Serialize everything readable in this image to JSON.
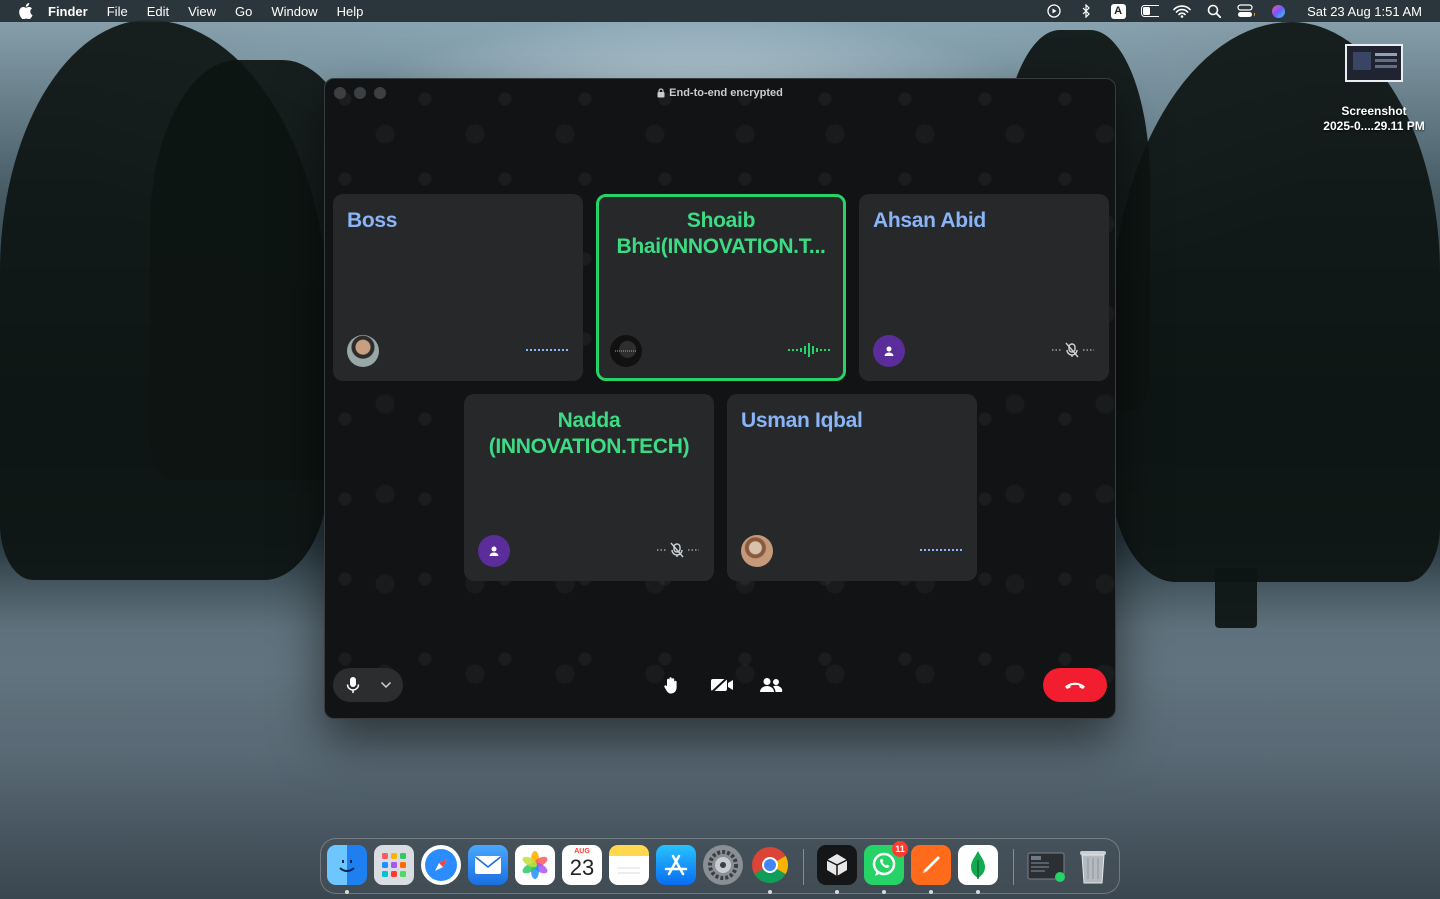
{
  "menubar": {
    "app_name": "Finder",
    "menus": [
      "File",
      "Edit",
      "View",
      "Go",
      "Window",
      "Help"
    ],
    "keyboard_input": "A",
    "clock": "Sat 23 Aug  1:51 AM"
  },
  "desktop": {
    "file_name_line1": "Screenshot",
    "file_name_line2": "2025-0....29.11 PM"
  },
  "call": {
    "encryption_label": "End-to-end encrypted",
    "participants": [
      {
        "name": "Boss",
        "status": "listening"
      },
      {
        "name": "Shoaib Bhai(INNOVATION.T...",
        "status": "speaking"
      },
      {
        "name": "Ahsan Abid",
        "status": "muted"
      },
      {
        "name": "Nadda (INNOVATION.TECH)",
        "status": "muted"
      },
      {
        "name": "Usman Iqbal",
        "status": "listening"
      }
    ],
    "colors": {
      "speaking": "#25d366",
      "name": "#8ab4f8",
      "end_call": "#f21d2f"
    }
  },
  "dock": {
    "apps": [
      "Finder",
      "Launchpad",
      "Safari",
      "Mail",
      "Photos",
      "Calendar",
      "Notes",
      "App Store",
      "System Settings",
      "Google Chrome",
      "Cursor",
      "WhatsApp",
      "Sublime",
      "MongoDB Compass",
      "Preview",
      "Trash"
    ],
    "calendar_month": "AUG",
    "calendar_day": "23",
    "whatsapp_badge": "11"
  }
}
